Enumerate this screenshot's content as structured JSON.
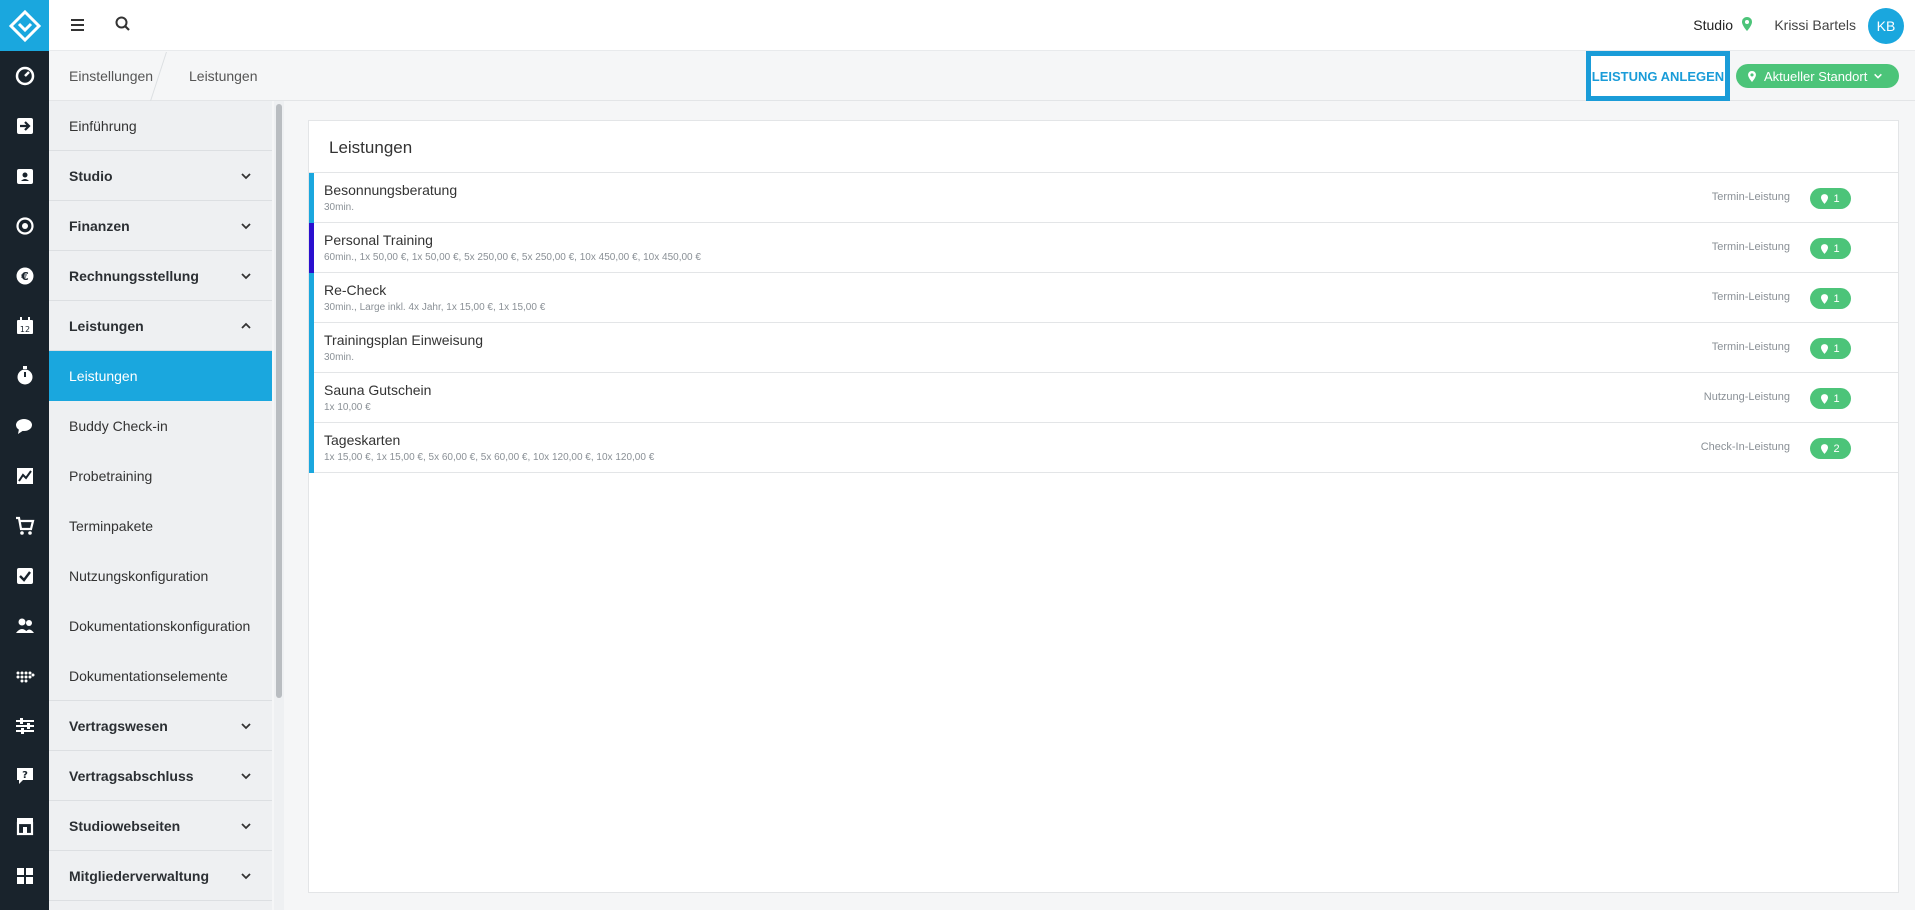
{
  "topbar": {
    "studio_label": "Studio",
    "user_name": "Krissi Bartels",
    "avatar_initials": "KB"
  },
  "breadcrumb": [
    "Einstellungen",
    "Leistungen"
  ],
  "actions": {
    "add_label": "LEISTUNG ANLEGEN",
    "location_label": "Aktueller Standort"
  },
  "rail_icons": [
    "dashboard-icon",
    "checkin-icon",
    "contacts-icon",
    "settings-gear-icon",
    "euro-icon",
    "calendar-icon",
    "stopwatch-icon",
    "chat-icon",
    "chart-icon",
    "cart-icon",
    "tasks-icon",
    "members-icon",
    "devices-icon",
    "sliders-icon",
    "help-icon",
    "shop-icon",
    "apps-icon"
  ],
  "sidebar": {
    "intro": "Einführung",
    "studio": "Studio",
    "finanzen": "Finanzen",
    "rechnung": "Rechnungsstellung",
    "leistungen_section": "Leistungen",
    "sub_items": [
      "Leistungen",
      "Buddy Check-in",
      "Probetraining",
      "Terminpakete",
      "Nutzungskonfiguration",
      "Dokumentationskonfiguration",
      "Dokumentationselemente"
    ],
    "vertragswesen": "Vertragswesen",
    "vertragsabschluss": "Vertragsabschluss",
    "studiowebseiten": "Studiowebseiten",
    "mitglieder": "Mitgliederverwaltung"
  },
  "panel": {
    "title": "Leistungen",
    "rows": [
      {
        "name": "Besonnungsberatung",
        "detail": "30min.",
        "type": "Termin-Leistung",
        "count": "1",
        "color": "#1aa7de"
      },
      {
        "name": "Personal Training",
        "detail": "60min., 1x 50,00 €, 1x 50,00 €, 5x 250,00 €, 5x 250,00 €, 10x 450,00 €, 10x 450,00 €",
        "type": "Termin-Leistung",
        "count": "1",
        "color": "#2a0fcf"
      },
      {
        "name": "Re-Check",
        "detail": "30min., Large inkl. 4x Jahr, 1x 15,00 €, 1x 15,00 €",
        "type": "Termin-Leistung",
        "count": "1",
        "color": "#1aa7de"
      },
      {
        "name": "Trainingsplan Einweisung",
        "detail": "30min.",
        "type": "Termin-Leistung",
        "count": "1",
        "color": "#1aa7de"
      },
      {
        "name": "Sauna Gutschein",
        "detail": "1x 10,00 €",
        "type": "Nutzung-Leistung",
        "count": "1",
        "color": "#1aa7de"
      },
      {
        "name": "Tageskarten",
        "detail": "1x 15,00 €, 1x 15,00 €, 5x 60,00 €, 5x 60,00 €, 10x 120,00 €, 10x 120,00 €",
        "type": "Check-In-Leistung",
        "count": "2",
        "color": "#1aa7de"
      }
    ]
  },
  "colors": {
    "accent": "#1aa7de",
    "rail": "#19232c",
    "success": "#4cc479",
    "highlight_border": "#1a9cd8"
  }
}
